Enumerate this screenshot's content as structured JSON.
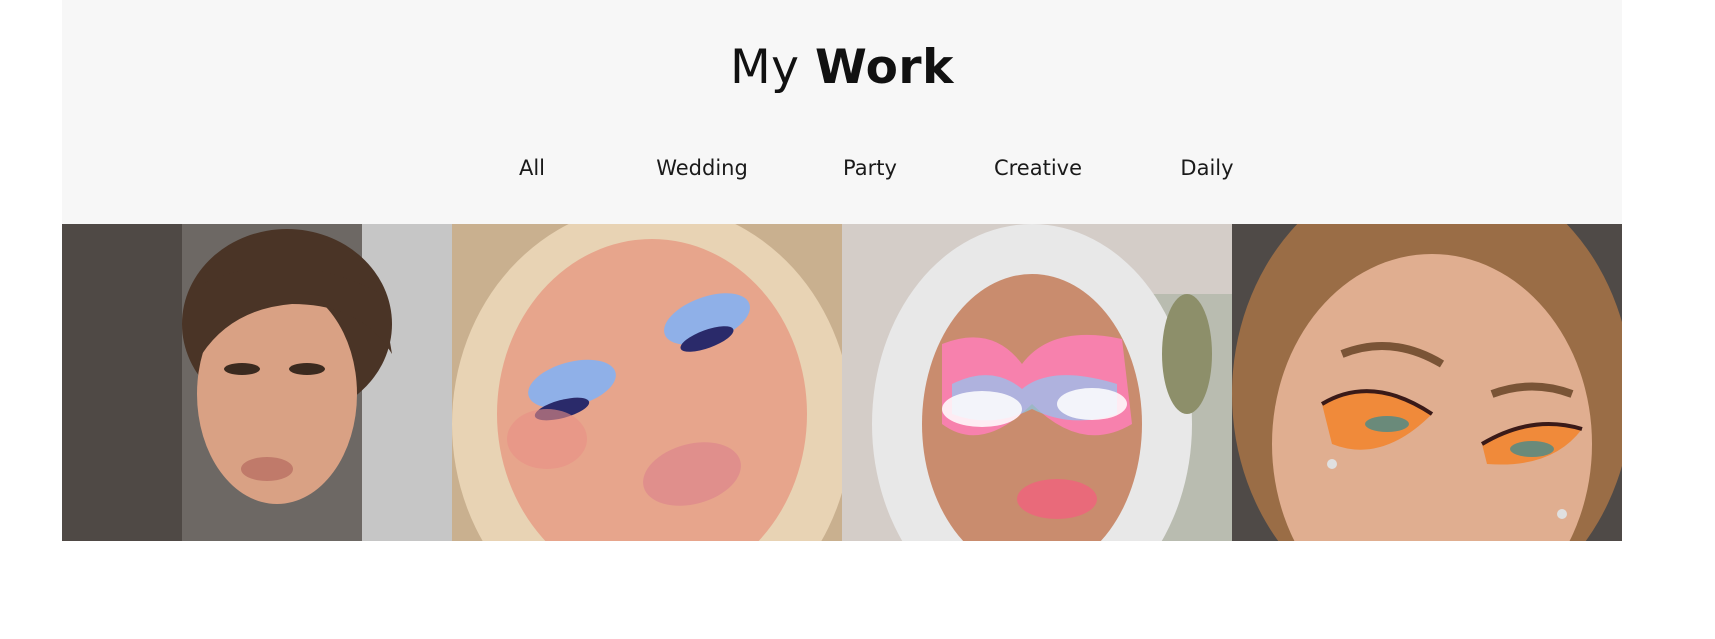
{
  "heading": {
    "prefix": "My",
    "emphasis": "Work"
  },
  "filters": [
    "All",
    "Wedding",
    "Party",
    "Creative",
    "Daily"
  ],
  "gallery": [
    {
      "name": "portfolio-image-natural-glam",
      "bg": "#7a7470",
      "skin": "#d9a184",
      "hair": "#4a3426",
      "eye": "#5a3b2b",
      "lip": "#c07a6a"
    },
    {
      "name": "portfolio-image-blue-eyeshadow",
      "bg": "#b9a48b",
      "skin": "#e7a58c",
      "hair": "#e8d3b4",
      "eye": "#8fb0e8",
      "lip": "#e08f8c"
    },
    {
      "name": "portfolio-image-rainbow-clouds",
      "bg": "#cfc9c5",
      "skin": "#c98c6e",
      "hair": "#e8e8e8",
      "eye": "#ff7fb8",
      "lip": "#e96a7a"
    },
    {
      "name": "portfolio-image-butterfly-wings",
      "bg": "#5b5552",
      "skin": "#e0ae90",
      "hair": "#9a6d46",
      "eye": "#f08a3a",
      "lip": "#d98a74"
    }
  ]
}
